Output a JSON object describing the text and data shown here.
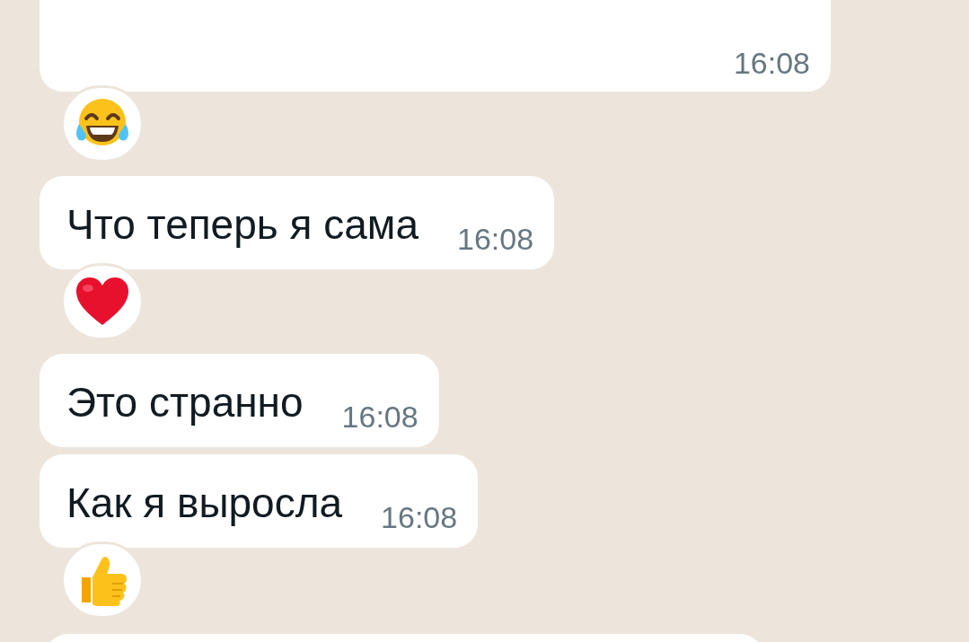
{
  "messages": [
    {
      "time": "16:08",
      "reaction": {
        "kind": "laugh"
      }
    },
    {
      "text": "Что теперь я сама",
      "time": "16:08",
      "reaction": {
        "kind": "heart"
      }
    },
    {
      "text": "Это странно",
      "time": "16:08"
    },
    {
      "text": "Как я выросла",
      "time": "16:08",
      "reaction": {
        "kind": "thumbs_up"
      }
    },
    {
      "kind": "partial"
    }
  ]
}
